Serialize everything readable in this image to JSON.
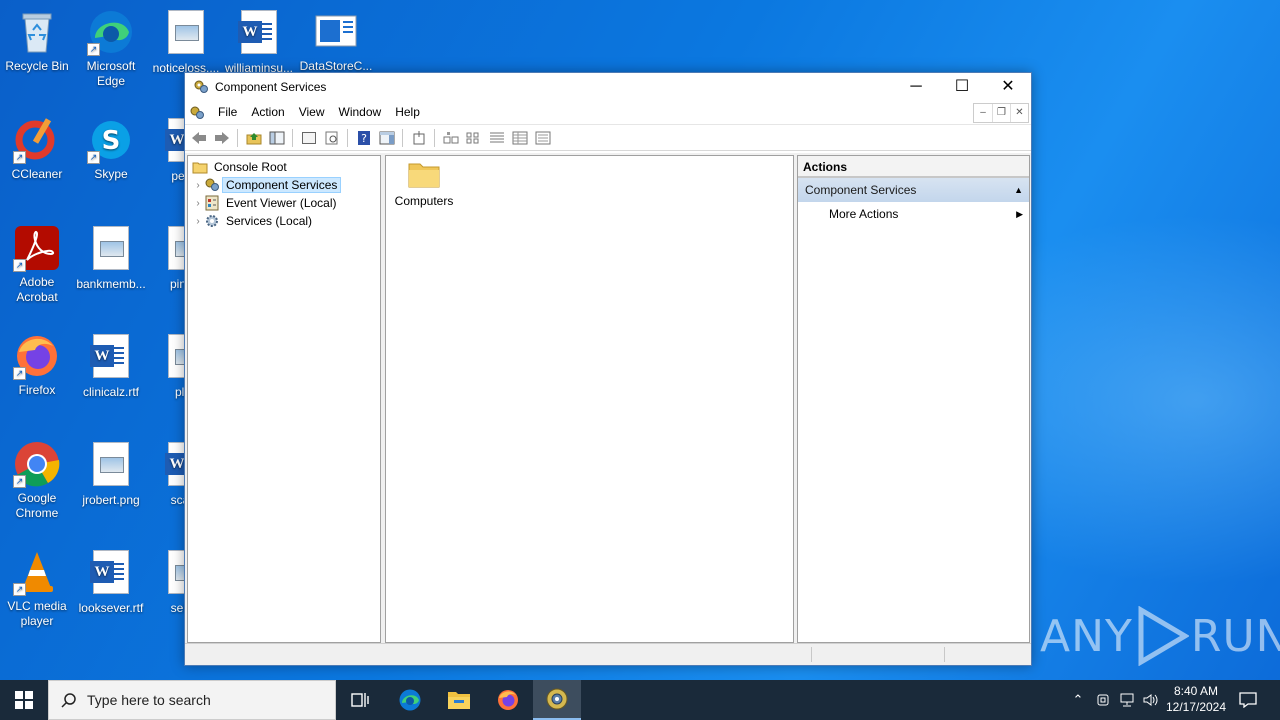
{
  "desktop": {
    "icons": [
      {
        "label": "Recycle Bin",
        "icon": "recycle-bin-icon"
      },
      {
        "label": "Microsoft Edge",
        "icon": "edge-icon"
      },
      {
        "label": "noticeloss....",
        "icon": "image-file-icon"
      },
      {
        "label": "williaminsu...",
        "icon": "word-doc-icon"
      },
      {
        "label": "DataStoreC...",
        "icon": "datastore-icon"
      },
      {
        "label": "CCleaner",
        "icon": "ccleaner-icon"
      },
      {
        "label": "Skype",
        "icon": "skype-icon"
      },
      {
        "label": "peopl",
        "icon": "word-doc-icon"
      },
      {
        "label": "Adobe Acrobat",
        "icon": "acrobat-icon"
      },
      {
        "label": "bankmemb...",
        "icon": "image-file-icon"
      },
      {
        "label": "pinkm",
        "icon": "image-file-icon"
      },
      {
        "label": "Firefox",
        "icon": "firefox-icon"
      },
      {
        "label": "clinicalz.rtf",
        "icon": "word-doc-icon"
      },
      {
        "label": "play",
        "icon": "image-file-icon"
      },
      {
        "label": "Google Chrome",
        "icon": "chrome-icon"
      },
      {
        "label": "jrobert.png",
        "icon": "image-file-icon"
      },
      {
        "label": "scalei",
        "icon": "word-doc-icon"
      },
      {
        "label": "VLC media player",
        "icon": "vlc-icon"
      },
      {
        "label": "looksever.rtf",
        "icon": "word-doc-icon"
      },
      {
        "label": "sellev",
        "icon": "image-file-icon"
      }
    ]
  },
  "window": {
    "title": "Component Services",
    "menus": [
      "File",
      "Action",
      "View",
      "Window",
      "Help"
    ],
    "tree": {
      "root": "Console Root",
      "items": [
        {
          "label": "Component Services",
          "selected": true
        },
        {
          "label": "Event Viewer (Local)",
          "selected": false
        },
        {
          "label": "Services (Local)",
          "selected": false
        }
      ]
    },
    "results": {
      "items": [
        {
          "label": "Computers",
          "icon": "folder-icon"
        }
      ]
    },
    "actions": {
      "header": "Actions",
      "section": "Component Services",
      "items": [
        "More Actions"
      ]
    }
  },
  "taskbar": {
    "search_placeholder": "Type here to search",
    "time": "8:40 AM",
    "date": "12/17/2024"
  },
  "watermark": {
    "left": "ANY",
    "right": "RUN"
  },
  "colors": {
    "desktop": "#0b78e0",
    "taskbar": "#1a2a3a",
    "selection": "#cce8ff",
    "actions_section": "#c3d6ec"
  }
}
